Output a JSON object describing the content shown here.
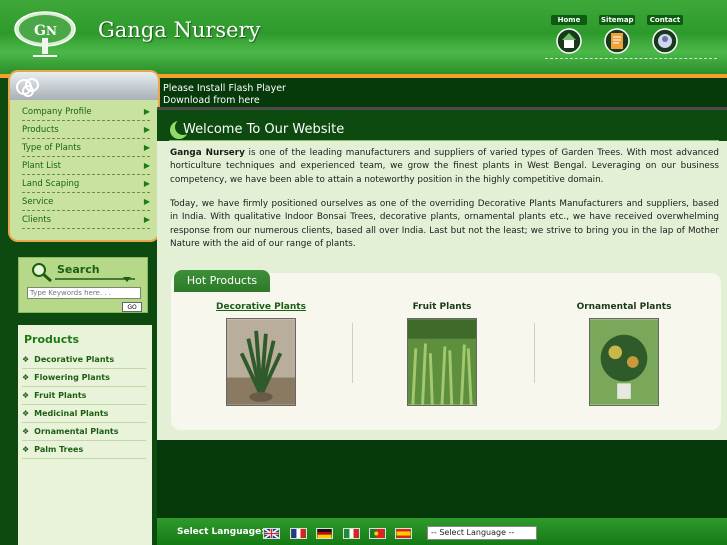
{
  "header": {
    "brand": "Ganga Nursery",
    "logo_letters": "GN",
    "topnav": [
      {
        "label": "Home",
        "icon": "home-icon"
      },
      {
        "label": "Sitemap",
        "icon": "sitemap-icon"
      },
      {
        "label": "Contact",
        "icon": "contact-icon"
      }
    ]
  },
  "menu": {
    "items": [
      {
        "label": "Company Profile"
      },
      {
        "label": "Products"
      },
      {
        "label": "Type of Plants"
      },
      {
        "label": "Plant List"
      },
      {
        "label": "Land Scaping"
      },
      {
        "label": "Service"
      },
      {
        "label": "Clients"
      }
    ]
  },
  "search": {
    "title": "Search",
    "placeholder": "Type Keywords here. . .",
    "button": "GO"
  },
  "products_panel": {
    "title": "Products",
    "items": [
      {
        "label": "Decorative Plants"
      },
      {
        "label": "Flowering Plants"
      },
      {
        "label": "Fruit Plants"
      },
      {
        "label": "Medicinal Plants"
      },
      {
        "label": "Ornamental Plants"
      },
      {
        "label": "Palm Trees"
      }
    ]
  },
  "flash": {
    "line1": "Please Install Flash Player",
    "line2": "Download from here"
  },
  "main": {
    "welcome": "Welcome To Our Website",
    "p1_brand": "Ganga Nursery",
    "p1_text": " is one of the leading manufacturers and suppliers of varied types of Garden Trees. With most advanced horticulture techniques and experienced team, we grow the finest plants in West Bengal. Leveraging on our business competency, we have been able to attain a noteworthy position in the highly competitive domain.",
    "p2": "Today, we have firmly positioned ourselves as one of the overriding Decorative Plants Manufacturers and suppliers, based in India. With qualitative Indoor Bonsai Trees, decorative plants, ornamental plants etc., we have received overwhelming response from our numerous clients, based all over India. Last but not the least; we strive to bring you in the lap of Mother Nature with the aid of our range of plants."
  },
  "hot_products": {
    "title": "Hot Products",
    "items": [
      {
        "name": "Decorative Plants"
      },
      {
        "name": "Fruit Plants"
      },
      {
        "name": "Ornamental Plants"
      }
    ]
  },
  "footer": {
    "language_label": "Select Language:",
    "flags": [
      "flag-uk-icon",
      "flag-france-icon",
      "flag-germany-icon",
      "flag-italy-icon",
      "flag-portugal-icon",
      "flag-spain-icon"
    ],
    "select_value": "-- Select Language --"
  },
  "colors": {
    "header_green": "#3fa83a",
    "accent_orange": "#f3a12b",
    "dark_green_bg": "#073a0b",
    "link_green": "#1e7a16"
  }
}
